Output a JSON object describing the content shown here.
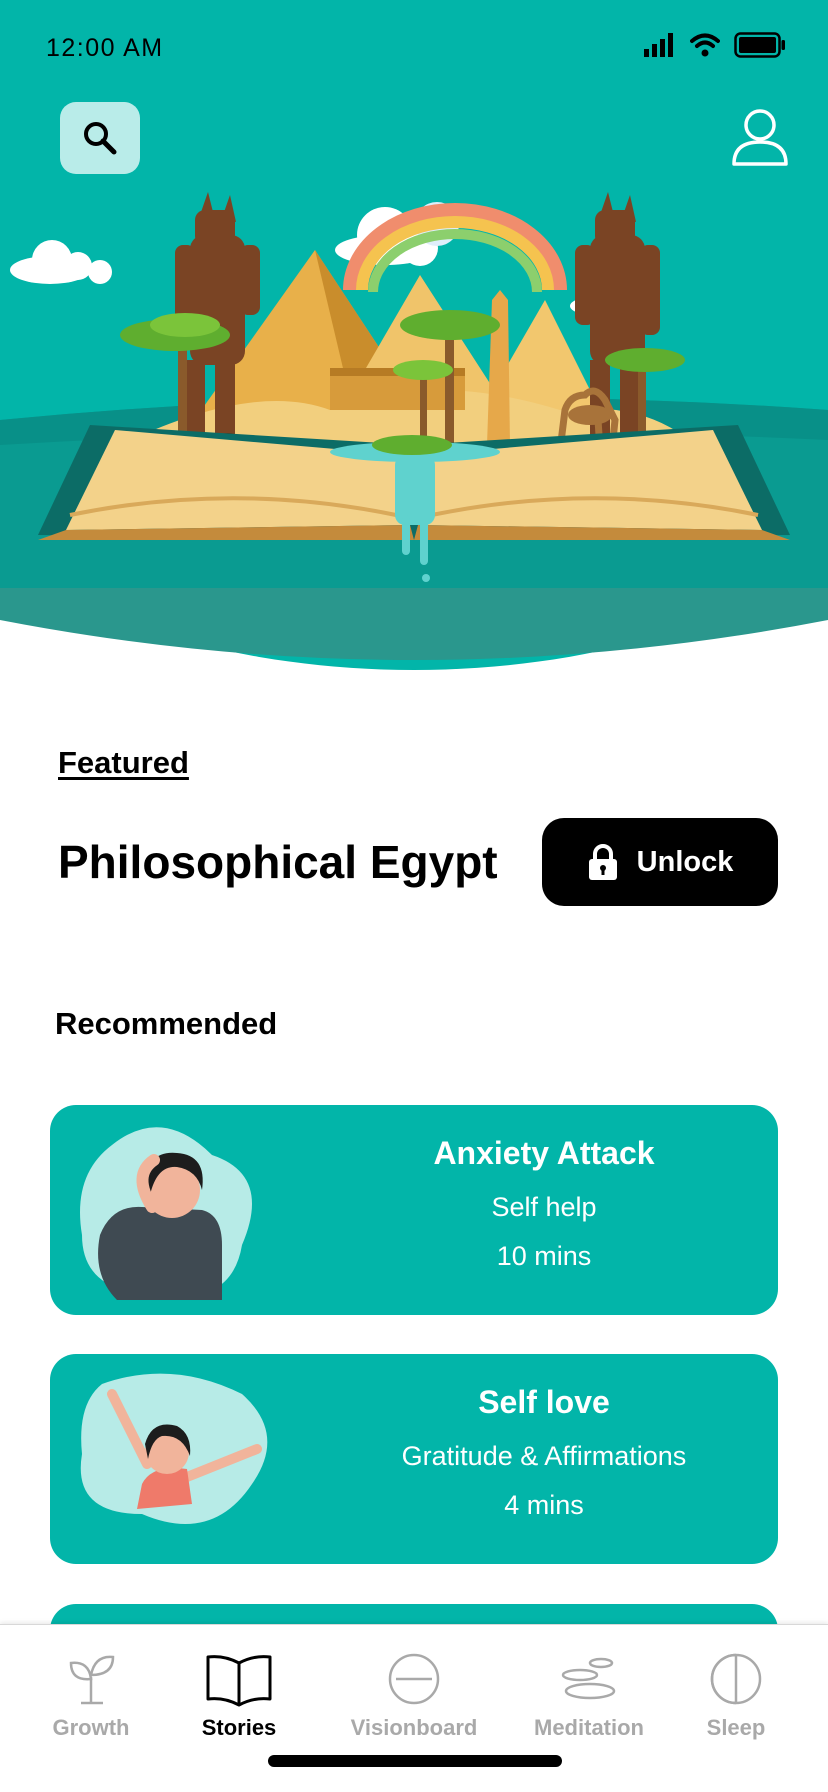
{
  "status_bar": {
    "time": "12:00 AM"
  },
  "header": {
    "search_icon": "search-icon",
    "profile_icon": "user-icon"
  },
  "featured": {
    "label": "Featured",
    "title": "Philosophical Egypt",
    "unlock_label": "Unlock",
    "unlock_icon": "lock-icon"
  },
  "recommended": {
    "label": "Recommended",
    "items": [
      {
        "title": "Anxiety Attack",
        "category": "Self help",
        "duration": "10 mins"
      },
      {
        "title": "Self love",
        "category": "Gratitude & Affirmations",
        "duration": "4 mins"
      }
    ]
  },
  "tabs": [
    {
      "label": "Growth",
      "icon": "sprout-icon",
      "active": false
    },
    {
      "label": "Stories",
      "icon": "book-icon",
      "active": true
    },
    {
      "label": "Visionboard",
      "icon": "circle-minus-icon",
      "active": false
    },
    {
      "label": "Meditation",
      "icon": "stones-icon",
      "active": false
    },
    {
      "label": "Sleep",
      "icon": "half-moon-icon",
      "active": false
    }
  ],
  "colors": {
    "teal": "#02b5a9",
    "teal_dark": "#0b8f86",
    "search_bg": "#b9ece9",
    "black": "#000000"
  }
}
